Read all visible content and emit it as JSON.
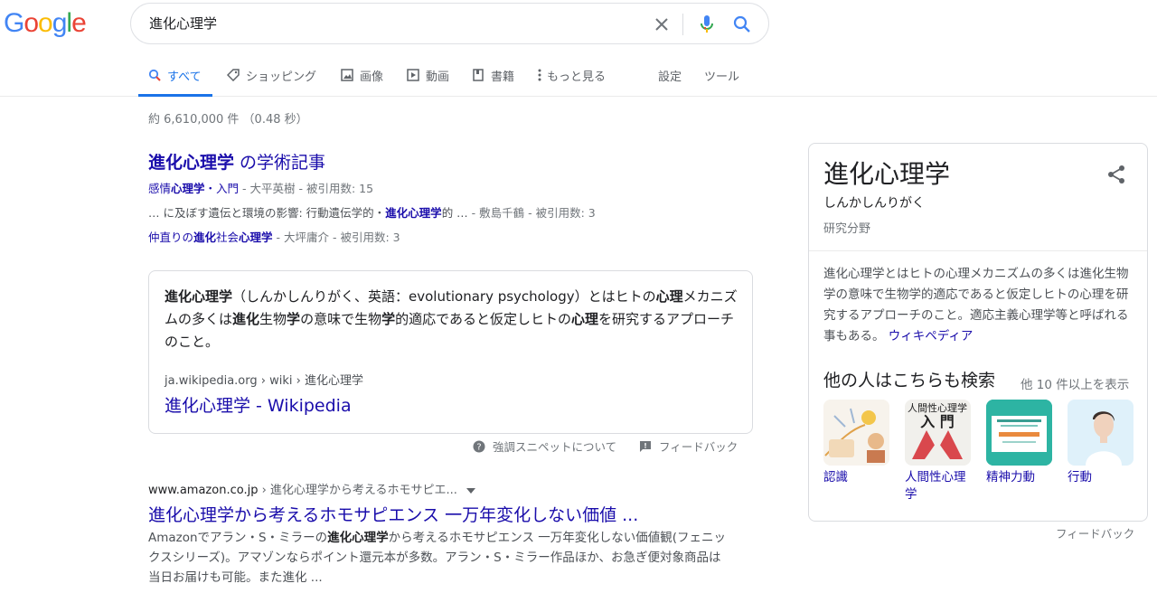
{
  "logo": {
    "letters": [
      "G",
      "o",
      "o",
      "g",
      "l",
      "e"
    ],
    "colors": [
      "#4285f4",
      "#ea4335",
      "#fbbc05",
      "#4285f4",
      "#34a853",
      "#ea4335"
    ]
  },
  "search": {
    "query": "進化心理学"
  },
  "icons": {
    "clear": "close-icon",
    "voice": "mic-icon",
    "search": "search-icon"
  },
  "tabs": [
    {
      "label": "すべて",
      "icon": "search-icon"
    },
    {
      "label": "ショッピング",
      "icon": "tag-icon"
    },
    {
      "label": "画像",
      "icon": "image-icon"
    },
    {
      "label": "動画",
      "icon": "video-icon"
    },
    {
      "label": "書籍",
      "icon": "book-icon"
    },
    {
      "label": "もっと見る",
      "icon": "more-vert-icon"
    }
  ],
  "tools": {
    "settings": "設定",
    "tools": "ツール"
  },
  "stats": "約 6,610,000 件 （0.48 秒）",
  "scholar": {
    "title_bold": "進化心理学",
    "title_rest": " の学術記事",
    "rows": [
      {
        "link": [
          "感情",
          "心理学",
          "・入門"
        ],
        "meta": " - 大平英樹 - 被引用数: 15"
      },
      {
        "prefix": "… に及ぼす遺伝と環境の影響: 行動遺伝学的・",
        "bold": "進化心理学",
        "suffix": "的 …",
        "meta": " - 敷島千鶴 - 被引用数: 3"
      },
      {
        "link": [
          "仲直りの",
          "進化",
          "社会",
          "心理学"
        ],
        "meta": " - 大坪庸介 - 被引用数: 3"
      }
    ]
  },
  "snippet": {
    "text_parts": [
      "進化心理学",
      "（しんかしんりがく、英語：evolutionary psychology）とはヒトの",
      "心理",
      "メカニズムの多くは",
      "進化",
      "生物",
      "学",
      "の意味で生物",
      "学",
      "的適応であると仮定しヒトの",
      "心理",
      "を研究するアプローチのこと。"
    ],
    "cite": "ja.wikipedia.org › wiki › 進化心理学",
    "title": "進化心理学 - Wikipedia",
    "about": "強調スニペットについて",
    "feedback": "フィードバック"
  },
  "amazon": {
    "domain": "www.amazon.co.jp",
    "path": " › 進化心理学から考えるホモサピエ...",
    "title": "進化心理学から考えるホモサピエンス 一万年変化しない価値 ...",
    "desc_parts": [
      "Amazonでアラン・S・ミラーの",
      "進化心理学",
      "から考えるホモサピエンス 一万年変化しない価値観(フェニックスシリーズ)。アマゾンならポイント還元本が多数。アラン・S・ミラー作品ほか、お急ぎ便対象商品は当日お届けも可能。また進化 ..."
    ]
  },
  "knowledge": {
    "title": "進化心理学",
    "reading": "しんかしんりがく",
    "subtitle": "研究分野",
    "description": "進化心理学とはヒトの心理メカニズムの多くは進化生物学の意味で生物学的適応であると仮定しヒトの心理を研究するアプローチのこと。適応主義心理学等と呼ばれる事もある。",
    "wiki": "ウィキペディア",
    "also_title": "他の人はこちらも検索",
    "more": "他 10 件以上を表示",
    "items": [
      {
        "label": "認識"
      },
      {
        "label": "人間性心理学"
      },
      {
        "label": "精神力動"
      },
      {
        "label": "行動"
      }
    ],
    "thumb2_text": [
      "人間性心理学",
      "入 門"
    ],
    "feedback": "フィードバック"
  }
}
